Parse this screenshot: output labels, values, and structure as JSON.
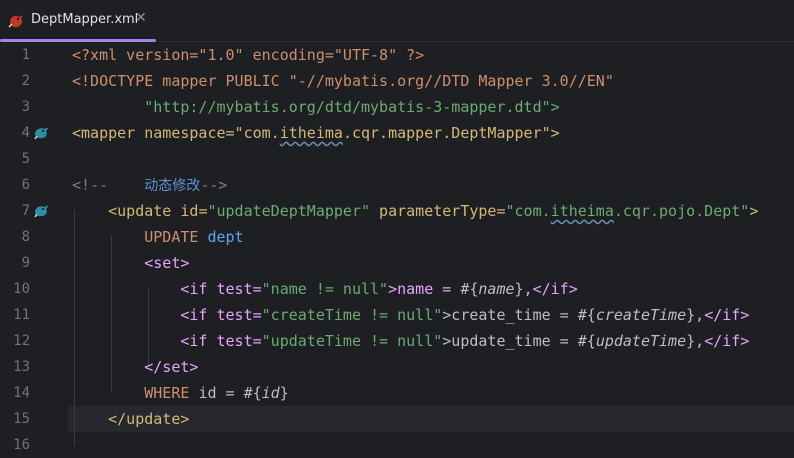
{
  "tab": {
    "filename": "DeptMapper.xml",
    "close_glyph": "✕"
  },
  "line_numbers": [
    "1",
    "2",
    "3",
    "4",
    "5",
    "6",
    "7",
    "8",
    "9",
    "10",
    "11",
    "12",
    "13",
    "14",
    "15",
    "16"
  ],
  "code": {
    "l1": [
      "<?xml version=\"1.0\" encoding=\"UTF-8\" ?>"
    ],
    "l2": [
      "<!DOCTYPE mapper PUBLIC \"-//mybatis.org//DTD Mapper 3.0//EN\""
    ],
    "l3": [
      "        \"http://mybatis.org/dtd/mybatis-3-mapper.dtd\">"
    ],
    "l4": [
      "<mapper namespace=\"com.",
      "itheima",
      ".cqr.mapper.DeptMapper\">"
    ],
    "l6": [
      "<!--    ",
      "动态修改",
      "-->"
    ],
    "l7": [
      "    <update ",
      "id",
      "=",
      "\"updateDeptMapper\"",
      " parameterType",
      "=",
      "\"com.",
      "itheima",
      ".cqr.pojo.Dept\"",
      ">"
    ],
    "l8": [
      "        UPDATE ",
      "dept"
    ],
    "l9": [
      "        <set>"
    ],
    "l10": [
      "            <if ",
      "test",
      "=",
      "\"name != null\"",
      ">name = ",
      "#{",
      "name",
      "}",
      ",",
      "</if>"
    ],
    "l11": [
      "            <if ",
      "test",
      "=",
      "\"createTime != null\"",
      ">create_time = ",
      "#{",
      "createTime",
      "}",
      ",",
      "</if>"
    ],
    "l12": [
      "            <if ",
      "test",
      "=",
      "\"updateTime != null\"",
      ">update_time = ",
      "#{",
      "updateTime",
      "}",
      ",",
      "</if>"
    ],
    "l13": [
      "        </set>"
    ],
    "l14": [
      "        WHERE ",
      "id = ",
      "#{",
      "id",
      "}"
    ],
    "l15": [
      "    </update>"
    ]
  },
  "colors": {
    "accent": "#a883e6",
    "tag": "#d5b778",
    "string": "#6aab73"
  },
  "icons": {
    "file": "mybatis-bird-icon",
    "gutter": "mybatis-bird-icon"
  }
}
